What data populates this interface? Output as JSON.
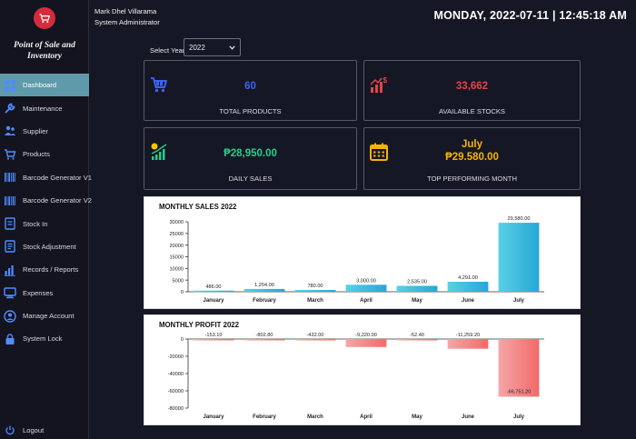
{
  "app": {
    "name_line1": "Point of Sale and",
    "name_line2": "Inventory"
  },
  "user": {
    "name": "Mark Dhel Villarama",
    "role": "System Administrator"
  },
  "datetime": "MONDAY, 2022-07-11 | 12:45:18 AM",
  "year_filter": {
    "label": "Select Year",
    "selected": "2022"
  },
  "sidebar": {
    "items": [
      {
        "label": "Dashboard",
        "icon": "dashboard-icon",
        "active": true
      },
      {
        "label": "Maintenance",
        "icon": "wrench-icon"
      },
      {
        "label": "Supplier",
        "icon": "supplier-icon"
      },
      {
        "label": "Products",
        "icon": "cart-icon"
      },
      {
        "label": "Barcode Generator V1",
        "icon": "barcode-icon"
      },
      {
        "label": "Barcode Generator V2",
        "icon": "barcode-icon"
      },
      {
        "label": "Stock In",
        "icon": "stock-in-icon"
      },
      {
        "label": "Stock Adjustment",
        "icon": "stock-adjustment-icon"
      },
      {
        "label": "Records / Reports",
        "icon": "reports-icon"
      },
      {
        "label": "Expenses",
        "icon": "expenses-icon"
      },
      {
        "label": "Manage Account",
        "icon": "account-icon"
      },
      {
        "label": "System Lock",
        "icon": "lock-icon"
      }
    ],
    "logout_label": "Logout"
  },
  "cards": {
    "total_products": {
      "value": "60",
      "label": "TOTAL PRODUCTS",
      "color": "#3b63f3"
    },
    "available_stocks": {
      "value": "33,662",
      "label": "AVAILABLE STOCKS",
      "color": "#e8424a"
    },
    "daily_sales": {
      "value": "₱28,950.00",
      "label": "DAILY SALES",
      "color": "#1fd18a"
    },
    "top_month": {
      "month": "July",
      "value": "₱29.580.00",
      "label": "TOP PERFORMING MONTH",
      "color": "#f5b400"
    }
  },
  "chart_data": [
    {
      "type": "bar",
      "title": "MONTHLY SALES 2022",
      "categories": [
        "January",
        "February",
        "March",
        "April",
        "May",
        "June",
        "July"
      ],
      "values": [
        486.0,
        1204.0,
        780.0,
        3000.0,
        2535.0,
        4291.0,
        29580.0
      ],
      "data_labels": [
        "486.00",
        "1,204.00",
        "780.00",
        "3,000.00",
        "2,535.00",
        "4,291.00",
        "29,580.00"
      ],
      "ylim": [
        0,
        30000
      ],
      "yticks": [
        0,
        5000,
        10000,
        15000,
        20000,
        25000,
        30000
      ],
      "grid": false,
      "colors": [
        "#27a6d8",
        "#58d1e6"
      ]
    },
    {
      "type": "bar",
      "title": "MONTHLY PROFIT 2022",
      "categories": [
        "January",
        "February",
        "March",
        "April",
        "May",
        "June",
        "July"
      ],
      "values": [
        -153.1,
        -802.8,
        -432.0,
        -9220.0,
        -52.4,
        -11259.2,
        -66751.2
      ],
      "data_labels": [
        "-153.10",
        "-802.80",
        "-432.00",
        "-9,220.00",
        "-52.40",
        "-11,259.20",
        "-66,751.20"
      ],
      "ylim": [
        -80000,
        0
      ],
      "yticks": [
        0,
        -20000,
        -40000,
        -60000,
        -80000
      ],
      "grid": false,
      "colors": [
        "#f26a6a",
        "#f5a6a6"
      ]
    }
  ]
}
